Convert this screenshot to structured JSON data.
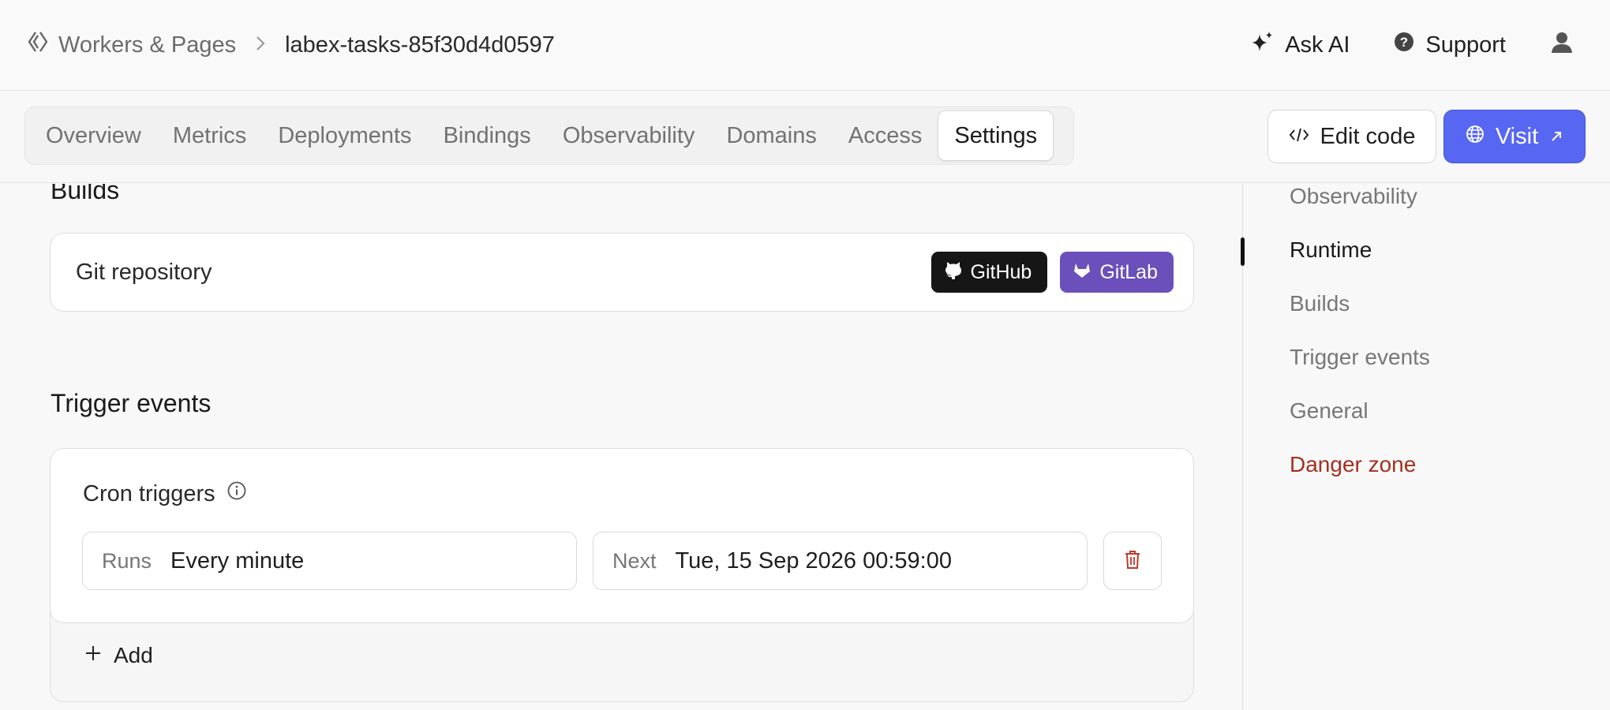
{
  "header": {
    "breadcrumb_root": "Workers & Pages",
    "breadcrumb_separator": ">",
    "breadcrumb_current": "labex-tasks-85f30d4d0597",
    "ask_ai_label": "Ask AI",
    "support_label": "Support"
  },
  "tabs": [
    {
      "label": "Overview",
      "active": false
    },
    {
      "label": "Metrics",
      "active": false
    },
    {
      "label": "Deployments",
      "active": false
    },
    {
      "label": "Bindings",
      "active": false
    },
    {
      "label": "Observability",
      "active": false
    },
    {
      "label": "Domains",
      "active": false
    },
    {
      "label": "Access",
      "active": false
    },
    {
      "label": "Settings",
      "active": true
    }
  ],
  "actions": {
    "edit_code_label": "Edit code",
    "visit_label": "Visit"
  },
  "builds": {
    "title": "Builds",
    "git_label": "Git repository",
    "github_label": "GitHub",
    "gitlab_label": "GitLab"
  },
  "trigger_events": {
    "title": "Trigger events",
    "cron_title": "Cron triggers",
    "runs_label": "Runs",
    "runs_value": "Every minute",
    "next_label": "Next",
    "next_value": "Tue, 15 Sep 2026 00:59:00",
    "add_label": "Add"
  },
  "sidenav": {
    "items": [
      {
        "label": "Observability"
      },
      {
        "label": "Runtime"
      },
      {
        "label": "Builds"
      },
      {
        "label": "Trigger events"
      },
      {
        "label": "General"
      },
      {
        "label": "Danger zone"
      }
    ],
    "active_item": "Runtime"
  },
  "colors": {
    "accent": "#5867f2",
    "github": "#161616",
    "gitlab": "#6b4fbb",
    "danger": "#a33020"
  }
}
